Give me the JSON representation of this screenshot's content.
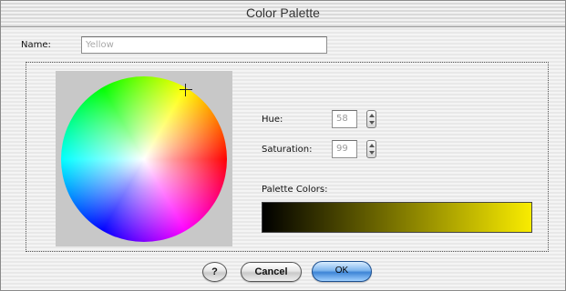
{
  "window": {
    "title": "Color Palette"
  },
  "name_row": {
    "label": "Name:",
    "value": "Yellow"
  },
  "hue": {
    "label": "Hue:",
    "value": "58"
  },
  "saturation": {
    "label": "Saturation:",
    "value": "99"
  },
  "palette": {
    "label": "Palette Colors:",
    "gradient_start": "#000000",
    "gradient_end": "#f9ec00"
  },
  "buttons": {
    "help": "?",
    "cancel": "Cancel",
    "ok": "OK"
  },
  "colors": {
    "accent_button": "#3d84d6",
    "wheel_background": "#c8c8c8"
  }
}
